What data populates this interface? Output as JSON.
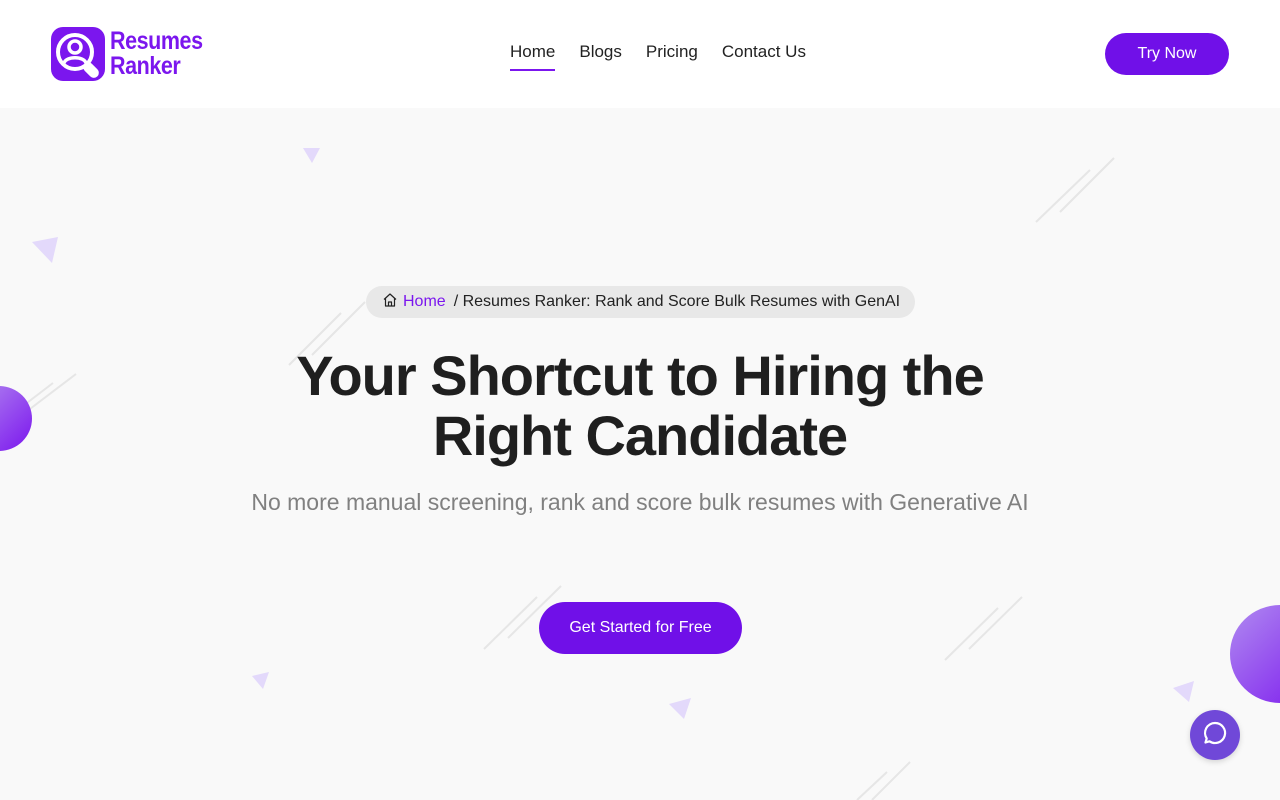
{
  "brand": {
    "line1": "Resumes",
    "line2": "Ranker",
    "color": "#7b16ee"
  },
  "nav": {
    "items": [
      {
        "label": "Home",
        "active": true
      },
      {
        "label": "Blogs",
        "active": false
      },
      {
        "label": "Pricing",
        "active": false
      },
      {
        "label": "Contact Us",
        "active": false
      }
    ],
    "cta_label": "Try Now"
  },
  "breadcrumb": {
    "home_icon": "home-icon",
    "home_label": "Home",
    "current": "/ Resumes Ranker: Rank and Score Bulk Resumes with GenAI"
  },
  "hero": {
    "headline_line1": "Your Shortcut to Hiring the",
    "headline_line2": "Right Candidate",
    "subtitle": "No more manual screening, rank and score bulk resumes with Generative AI",
    "cta_label": "Get Started for Free"
  },
  "chat": {
    "icon": "chat-bubble-icon",
    "color": "#7048d8"
  },
  "colors": {
    "accent": "#7010e8",
    "background": "#f9f9f9"
  }
}
